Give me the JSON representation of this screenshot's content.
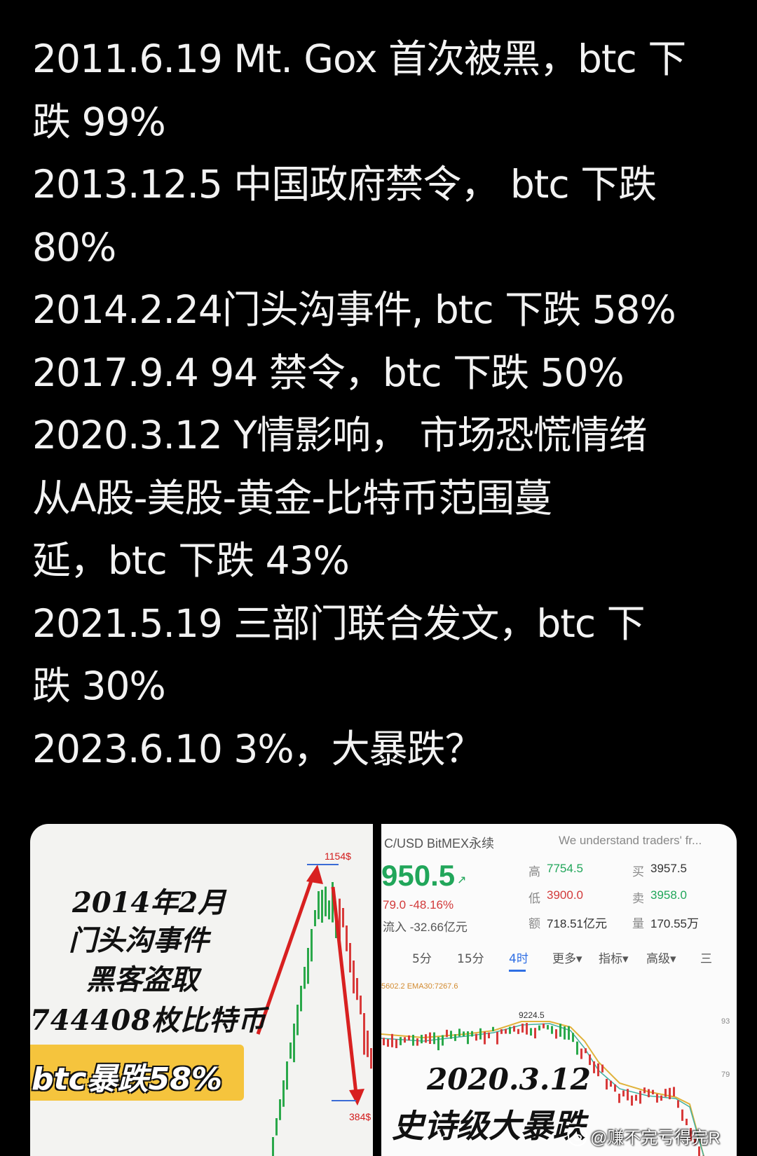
{
  "post": {
    "lines": [
      "2011.6.19  Mt. Gox 首次被黑，btc 下",
      "跌 99%",
      "2013.12.5  中国政府禁令，  btc 下跌",
      "80%",
      "2014.2.24门头沟事件, btc 下跌 58%",
      "2017.9.4  94 禁令，btc 下跌 50%",
      "2020.3.12  Y情影响，  市场恐慌情绪",
      "从A股-美股-黄金-比特币范围蔓",
      "延，btc 下跌 43%",
      "2021.5.19  三部门联合发文，btc 下",
      "跌 30%",
      "2023.6.10  3%，大暴跌？"
    ]
  },
  "image_left": {
    "caption_lines": [
      "2014年2月",
      "门头沟事件",
      "黑客盗取",
      "744408枚比特币"
    ],
    "badge": "btc暴跌58%",
    "high_label": "1154$",
    "low_label": "384$"
  },
  "image_right": {
    "pair": "C/USD  BitMEX永续",
    "tagline": "We understand traders' fr...",
    "last_price": "950.5",
    "change": "79.0  -48.16%",
    "inflow": "流入   -32.66亿元",
    "stats": [
      {
        "label": "高",
        "value": "7754.5",
        "color": "#21a65a"
      },
      {
        "label": "买",
        "value": "3957.5",
        "color": "#333333"
      },
      {
        "label": "低",
        "value": "3900.0",
        "color": "#d23a3a"
      },
      {
        "label": "卖",
        "value": "3958.0",
        "color": "#21a65a"
      },
      {
        "label": "额",
        "value": "718.51亿元",
        "color": "#333333"
      },
      {
        "label": "量",
        "value": "170.55万",
        "color": "#333333"
      }
    ],
    "tabs": [
      "5分",
      "15分",
      "4时",
      "更多▾",
      "指标▾",
      "高级▾",
      "三"
    ],
    "active_tab": "4时",
    "ema": "5602.2 EMA30:7267.6",
    "price_mark": "9224.5",
    "axis_labels": [
      "93",
      "79"
    ],
    "caption_lines": [
      "2020.3.12",
      "史诗级大暴跌"
    ]
  },
  "watermark": "@赚不完亏得完R"
}
